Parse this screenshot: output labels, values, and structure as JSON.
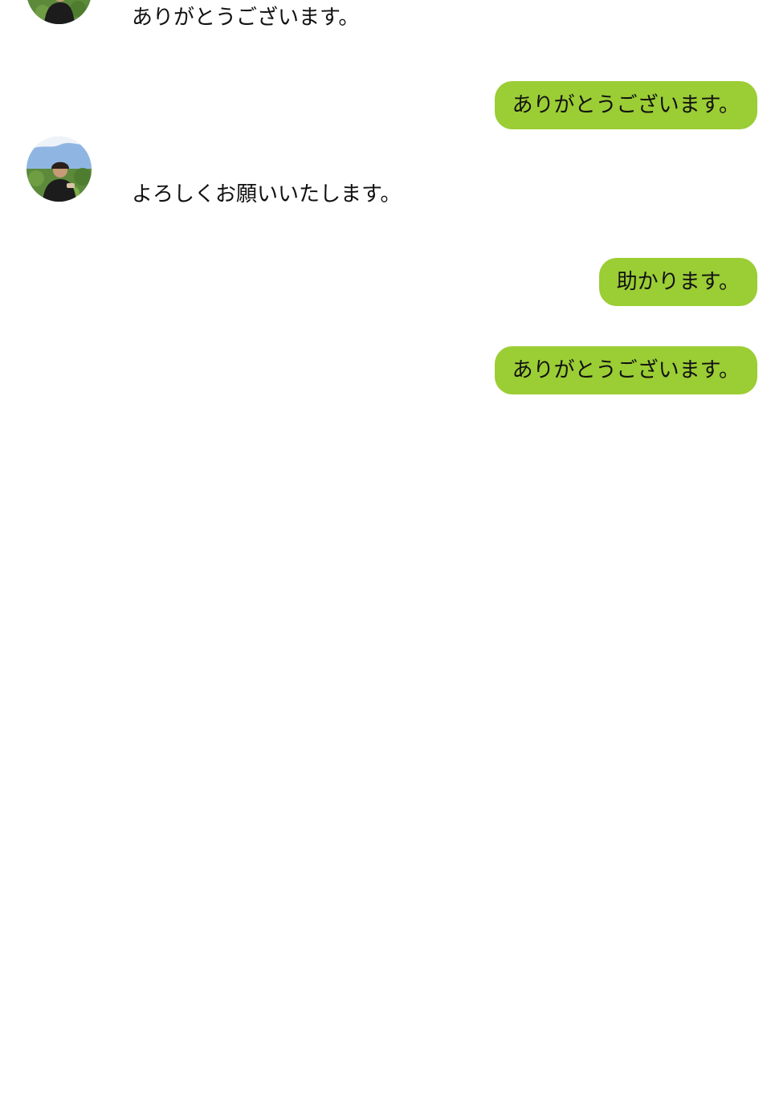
{
  "theme": {
    "bubble_color": "#9bcd35",
    "background": "#ffffff"
  },
  "messages": [
    {
      "direction": "incoming",
      "text": "ありがとうございます。",
      "avatar_icon": "user-avatar-photo"
    },
    {
      "direction": "outgoing",
      "text": "ありがとうございます。"
    },
    {
      "direction": "incoming",
      "text": "よろしくお願いいたします。",
      "avatar_icon": "user-avatar-photo"
    },
    {
      "direction": "outgoing",
      "text": "助かります。"
    },
    {
      "direction": "outgoing",
      "text": "ありがとうございます。"
    }
  ]
}
